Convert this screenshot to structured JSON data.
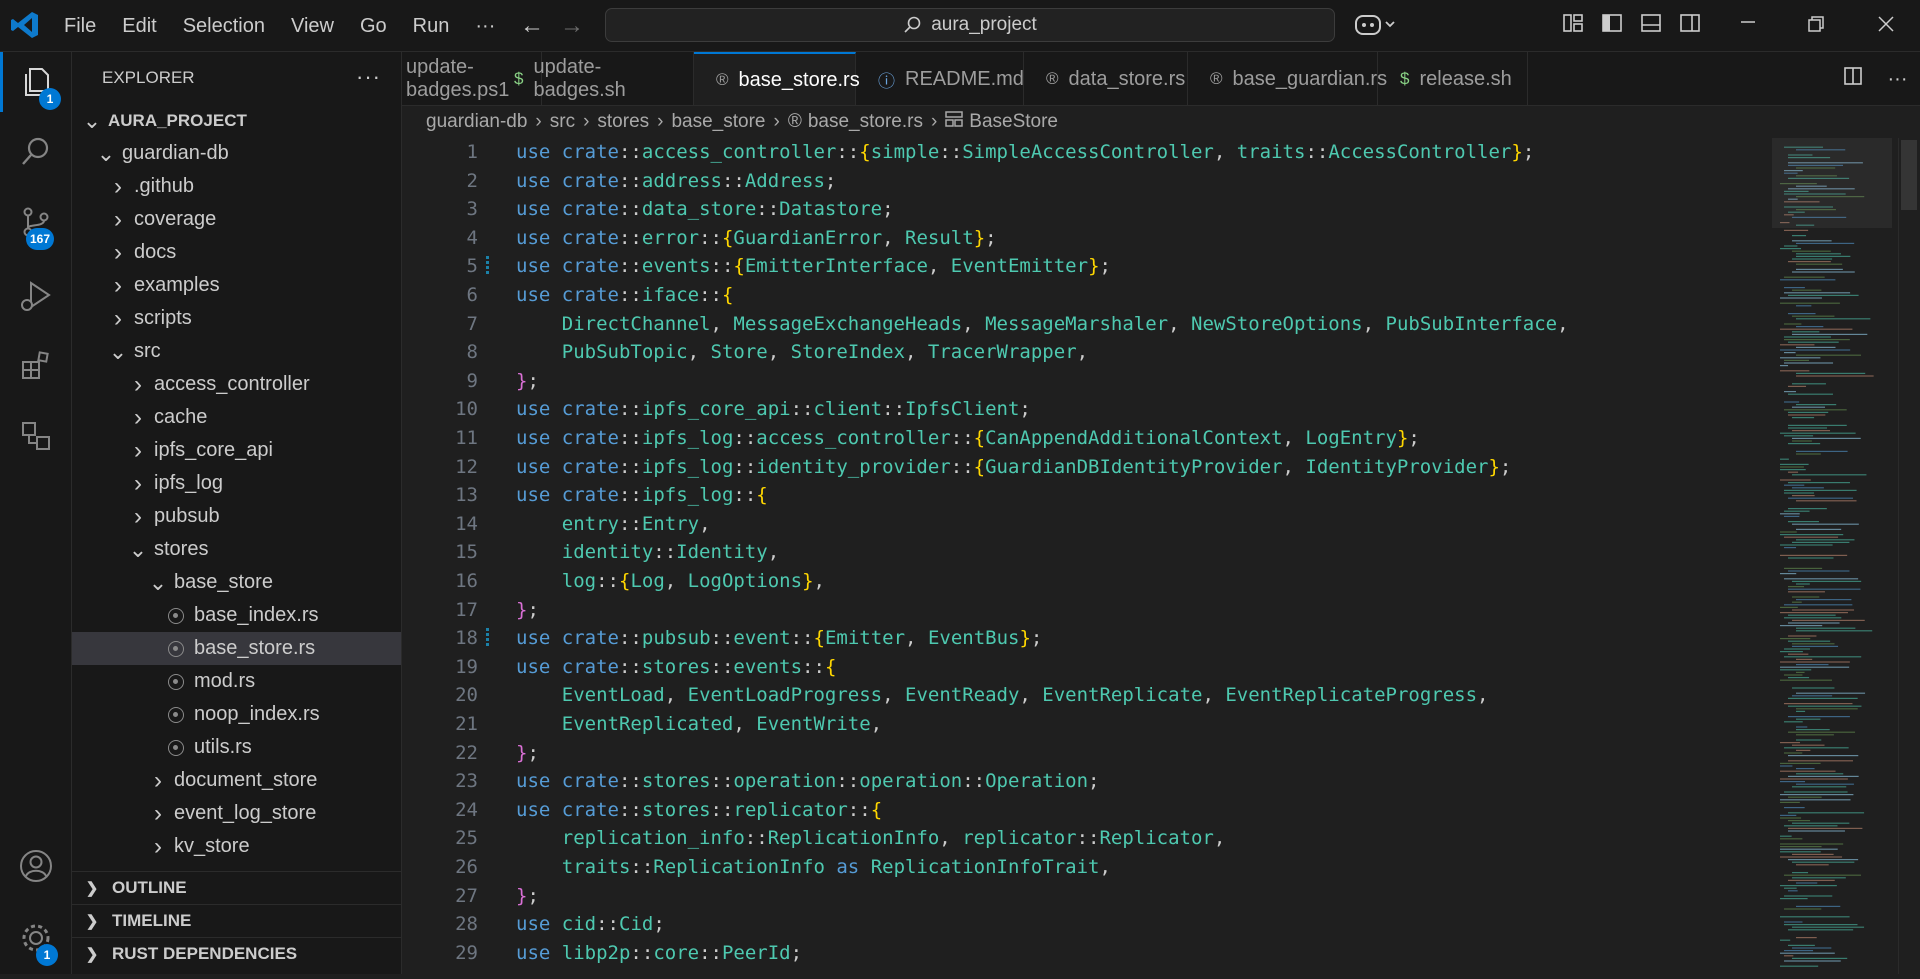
{
  "titlebar": {
    "menu": [
      "File",
      "Edit",
      "Selection",
      "View",
      "Go",
      "Run",
      "···"
    ],
    "search_text": "aura_project"
  },
  "activity": {
    "explorer_badge": "1",
    "scm_badge": "167",
    "settings_badge": "1"
  },
  "sidebar": {
    "header": "EXPLORER",
    "tree": [
      {
        "label": "AURA_PROJECT",
        "depth": 0,
        "chevron": "down",
        "bold": true
      },
      {
        "label": "guardian-db",
        "depth": 1,
        "chevron": "down"
      },
      {
        "label": ".github",
        "depth": 2,
        "chevron": "right"
      },
      {
        "label": "coverage",
        "depth": 2,
        "chevron": "right"
      },
      {
        "label": "docs",
        "depth": 2,
        "chevron": "right"
      },
      {
        "label": "examples",
        "depth": 2,
        "chevron": "right"
      },
      {
        "label": "scripts",
        "depth": 2,
        "chevron": "right"
      },
      {
        "label": "src",
        "depth": 2,
        "chevron": "down"
      },
      {
        "label": "access_controller",
        "depth": 3,
        "chevron": "right"
      },
      {
        "label": "cache",
        "depth": 3,
        "chevron": "right"
      },
      {
        "label": "ipfs_core_api",
        "depth": 3,
        "chevron": "right"
      },
      {
        "label": "ipfs_log",
        "depth": 3,
        "chevron": "right"
      },
      {
        "label": "pubsub",
        "depth": 3,
        "chevron": "right"
      },
      {
        "label": "stores",
        "depth": 3,
        "chevron": "down"
      },
      {
        "label": "base_store",
        "depth": 4,
        "chevron": "down"
      },
      {
        "label": "base_index.rs",
        "depth": 5,
        "file": true
      },
      {
        "label": "base_store.rs",
        "depth": 5,
        "file": true,
        "selected": true
      },
      {
        "label": "mod.rs",
        "depth": 5,
        "file": true
      },
      {
        "label": "noop_index.rs",
        "depth": 5,
        "file": true
      },
      {
        "label": "utils.rs",
        "depth": 5,
        "file": true
      },
      {
        "label": "document_store",
        "depth": 4,
        "chevron": "right"
      },
      {
        "label": "event_log_store",
        "depth": 4,
        "chevron": "right"
      },
      {
        "label": "kv_store",
        "depth": 4,
        "chevron": "right"
      }
    ],
    "sections": [
      "OUTLINE",
      "TIMELINE",
      "RUST DEPENDENCIES"
    ]
  },
  "tabs": [
    {
      "label": "update-badges.ps1",
      "icon": "ps1-icon"
    },
    {
      "label": "update-badges.sh",
      "icon": "shell-icon"
    },
    {
      "label": "base_store.rs",
      "icon": "rust-icon",
      "active": true,
      "modified": true
    },
    {
      "label": "README.md",
      "icon": "info-icon"
    },
    {
      "label": "data_store.rs",
      "icon": "rust-icon"
    },
    {
      "label": "base_guardian.rs",
      "icon": "rust-icon"
    },
    {
      "label": "release.sh",
      "icon": "shell-icon"
    }
  ],
  "breadcrumb": [
    "guardian-db",
    "src",
    "stores",
    "base_store",
    "base_store.rs",
    "BaseStore"
  ],
  "editor": {
    "line_numbers": [
      "1",
      "2",
      "3",
      "4",
      "5",
      "6",
      "7",
      "8",
      "9",
      "10",
      "11",
      "12",
      "13",
      "14",
      "15",
      "16",
      "17",
      "18",
      "19",
      "20",
      "21",
      "22",
      "23",
      "24",
      "25",
      "26",
      "27",
      "28",
      "29"
    ],
    "lines": [
      "use crate::access_controller::{simple::SimpleAccessController, traits::AccessController};",
      "use crate::address::Address;",
      "use crate::data_store::Datastore;",
      "use crate::error::{GuardianError, Result};",
      "use crate::events::{EmitterInterface, EventEmitter};",
      "use crate::iface::{",
      "    DirectChannel, MessageExchangeHeads, MessageMarshaler, NewStoreOptions, PubSubInterface,",
      "    PubSubTopic, Store, StoreIndex, TracerWrapper,",
      "};",
      "use crate::ipfs_core_api::client::IpfsClient;",
      "use crate::ipfs_log::access_controller::{CanAppendAdditionalContext, LogEntry};",
      "use crate::ipfs_log::identity_provider::{GuardianDBIdentityProvider, IdentityProvider};",
      "use crate::ipfs_log::{",
      "    entry::Entry,",
      "    identity::Identity,",
      "    log::{Log, LogOptions},",
      "};",
      "use crate::pubsub::event::{Emitter, EventBus};",
      "use crate::stores::events::{",
      "    EventLoad, EventLoadProgress, EventReady, EventReplicate, EventReplicateProgress,",
      "    EventReplicated, EventWrite,",
      "};",
      "use crate::stores::operation::operation::Operation;",
      "use crate::stores::replicator::{",
      "    replication_info::ReplicationInfo, replicator::Replicator,",
      "    traits::ReplicationInfo as ReplicationInfoTrait,",
      "};",
      "use cid::Cid;",
      "use libp2p::core::PeerId;"
    ],
    "modified_lines": [
      5,
      18
    ]
  }
}
